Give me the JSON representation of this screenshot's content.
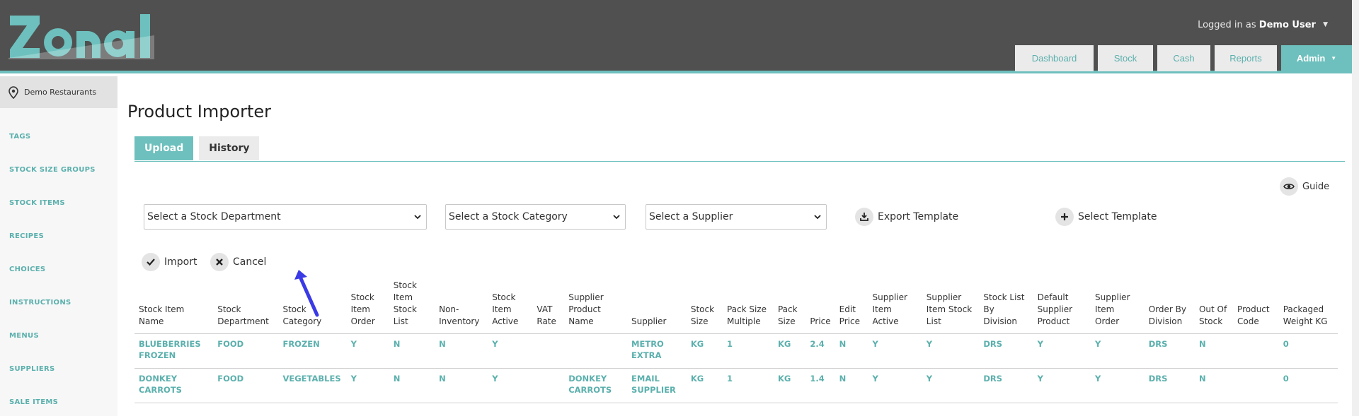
{
  "header": {
    "logo_text": "Zonal",
    "login_prefix": "Logged in as",
    "user_name": "Demo User",
    "nav": [
      {
        "label": "Dashboard"
      },
      {
        "label": "Stock"
      },
      {
        "label": "Cash"
      },
      {
        "label": "Reports"
      },
      {
        "label": "Admin"
      }
    ]
  },
  "sidebar": {
    "site_name": "Demo Restaurants",
    "items": [
      "TAGS",
      "STOCK SIZE GROUPS",
      "STOCK ITEMS",
      "RECIPES",
      "CHOICES",
      "INSTRUCTIONS",
      "MENUS",
      "SUPPLIERS",
      "SALE ITEMS"
    ]
  },
  "main": {
    "title": "Product Importer",
    "tabs": [
      {
        "label": "Upload"
      },
      {
        "label": "History"
      }
    ],
    "guide_label": "Guide",
    "selects": {
      "department": "Select a Stock Department",
      "category": "Select a Stock Category",
      "supplier": "Select a Supplier"
    },
    "export_label": "Export Template",
    "select_template_label": "Select Template",
    "import_label": "Import",
    "cancel_label": "Cancel"
  },
  "table": {
    "headers": [
      "Stock Item Name",
      "Stock Department",
      "Stock Category",
      "Stock Item Order",
      "Stock Item Stock List",
      "Non-Inventory",
      "Stock Item Active",
      "VAT Rate",
      "Supplier Product Name",
      "Supplier",
      "Stock Size",
      "Pack Size Multiple",
      "Pack Size",
      "Price",
      "Edit Price",
      "Supplier Item Active",
      "Supplier Item Stock List",
      "Stock List By Division",
      "Default Supplier Product",
      "Supplier Item Order",
      "Order By Division",
      "Out Of Stock",
      "Product Code",
      "Packaged Weight KG"
    ],
    "rows": [
      [
        "BLUEBERRIES FROZEN",
        "FOOD",
        "FROZEN",
        "Y",
        "N",
        "N",
        "Y",
        "",
        "",
        "METRO EXTRA",
        "KG",
        "1",
        "KG",
        "2.4",
        "N",
        "Y",
        "Y",
        "DRS",
        "Y",
        "Y",
        "DRS",
        "N",
        "",
        "0"
      ],
      [
        "DONKEY CARROTS",
        "FOOD",
        "VEGETABLES",
        "Y",
        "N",
        "N",
        "Y",
        "",
        "DONKEY CARROTS",
        "EMAIL SUPPLIER",
        "KG",
        "1",
        "KG",
        "1.4",
        "N",
        "Y",
        "Y",
        "DRS",
        "Y",
        "Y",
        "DRS",
        "N",
        "",
        "0"
      ]
    ]
  },
  "colors": {
    "accent": "#6dc0bd",
    "header_bg": "#505050",
    "arrow": "#3a3ae6"
  }
}
